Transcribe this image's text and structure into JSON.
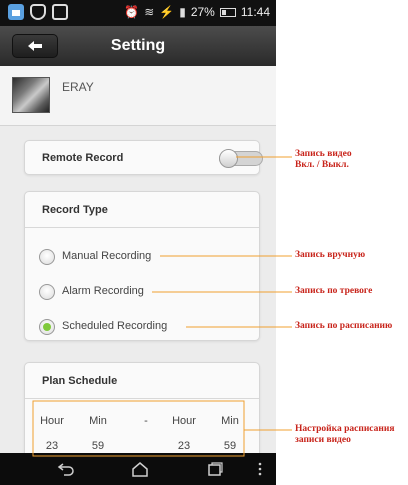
{
  "status_bar": {
    "battery": "27%",
    "time": "11:44"
  },
  "title_bar": {
    "title": "Setting",
    "back_icon": "back-arrow-icon"
  },
  "device": {
    "name": "ERAY"
  },
  "remote_record": {
    "label": "Remote Record",
    "enabled": false
  },
  "record_type": {
    "title": "Record Type",
    "options": [
      {
        "label": "Manual Recording",
        "selected": false
      },
      {
        "label": "Alarm Recording",
        "selected": false
      },
      {
        "label": "Scheduled Recording",
        "selected": true
      }
    ]
  },
  "plan_schedule": {
    "title": "Plan Schedule",
    "headers": [
      "Hour",
      "Min",
      "-",
      "Hour",
      "Min"
    ],
    "values": [
      "23",
      "59",
      "23",
      "59"
    ]
  },
  "annotations": {
    "remote_line1": "Запись видео",
    "remote_line2": "Вкл. / Выкл.",
    "manual": "Запись вручную",
    "alarm": "Запись по тревоге",
    "scheduled": "Запись по расписанию",
    "schedule_line1": "Настройка расписания",
    "schedule_line2": "записи видео",
    "color": "#c8241b",
    "line_color": "#f0a030"
  },
  "colors": {
    "title_bar": "#3a3a3a",
    "radio_selected": "#7fc93a",
    "background": "#ececec"
  }
}
